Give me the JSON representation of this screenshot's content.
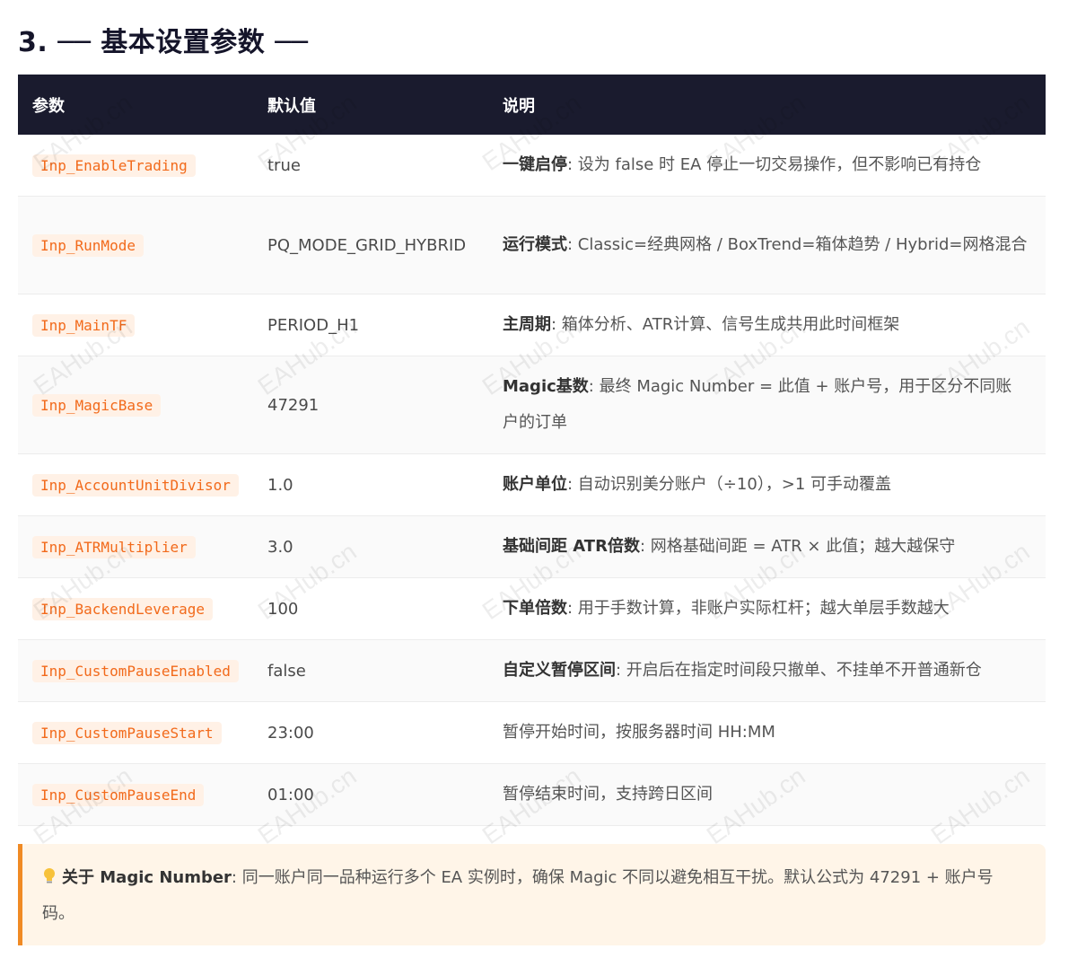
{
  "section": {
    "title": "3. ── 基本设置参数 ──"
  },
  "table": {
    "headers": [
      "参数",
      "默认值",
      "说明"
    ],
    "rows": [
      {
        "param": "Inp_EnableTrading",
        "default": "true",
        "term": "一键启停",
        "sep": ": ",
        "desc": "设为 false 时 EA 停止一切交易操作，但不影响已有持仓"
      },
      {
        "param": "Inp_RunMode",
        "default": "PQ_MODE_GRID_HYBRID",
        "term": "运行模式",
        "sep": ": ",
        "desc": "Classic=经典网格 / BoxTrend=箱体趋势 / Hybrid=网格混合"
      },
      {
        "param": "Inp_MainTF",
        "default": "PERIOD_H1",
        "term": "主周期",
        "sep": ": ",
        "desc": "箱体分析、ATR计算、信号生成共用此时间框架"
      },
      {
        "param": "Inp_MagicBase",
        "default": "47291",
        "term": "Magic基数",
        "sep": ": ",
        "desc": "最终 Magic Number = 此值 + 账户号，用于区分不同账户的订单"
      },
      {
        "param": "Inp_AccountUnitDivisor",
        "default": "1.0",
        "term": "账户单位",
        "sep": ": ",
        "desc": "自动识别美分账户（÷10），>1 可手动覆盖"
      },
      {
        "param": "Inp_ATRMultiplier",
        "default": "3.0",
        "term": "基础间距 ATR倍数",
        "sep": ": ",
        "desc": "网格基础间距 = ATR × 此值；越大越保守"
      },
      {
        "param": "Inp_BackendLeverage",
        "default": "100",
        "term": "下单倍数",
        "sep": ": ",
        "desc": "用于手数计算，非账户实际杠杆；越大单层手数越大"
      },
      {
        "param": "Inp_CustomPauseEnabled",
        "default": "false",
        "term": "自定义暂停区间",
        "sep": ": ",
        "desc": "开启后在指定时间段只撤单、不挂单不开普通新仓"
      },
      {
        "param": "Inp_CustomPauseStart",
        "default": "23:00",
        "term": "",
        "sep": "",
        "desc": "暂停开始时间，按服务器时间 HH:MM"
      },
      {
        "param": "Inp_CustomPauseEnd",
        "default": "01:00",
        "term": "",
        "sep": "",
        "desc": "暂停结束时间，支持跨日区间"
      }
    ]
  },
  "note": {
    "icon": "lightbulb-icon",
    "term": "关于 Magic Number",
    "sep": ": ",
    "text": "同一账户同一品种运行多个 EA 实例时，确保 Magic 不同以避免相互干扰。默认公式为 47291 + 账户号码。"
  },
  "watermark": "EAHub.cn",
  "colors": {
    "header_bg": "#1a1b2e",
    "param_text": "#f26a1b",
    "param_bg": "#fff1e6",
    "note_bg": "#fff5e8",
    "note_border": "#f08a24"
  }
}
